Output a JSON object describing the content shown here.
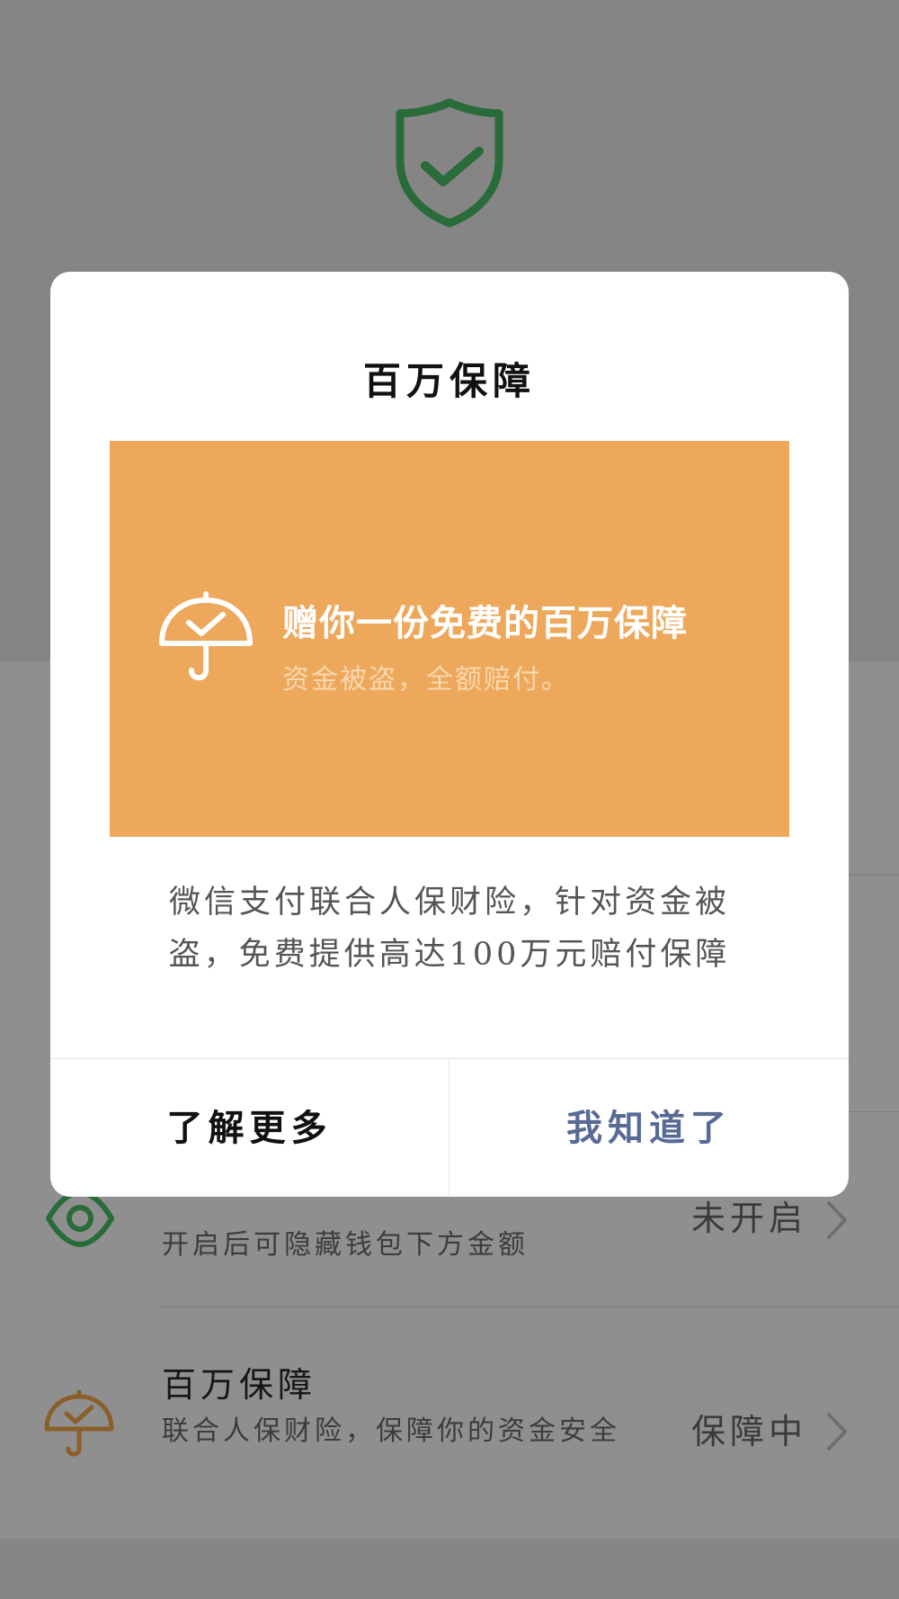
{
  "colors": {
    "overlay_bg": "#8a8a8a",
    "shield_green": "#2a6b3a",
    "banner_orange": "#eda85c",
    "primary_link": "#576b95",
    "umbrella_brown": "#8a5f2a"
  },
  "background": {
    "header_icon": "shield-check-icon",
    "rows": [
      {
        "icon": "eye-icon",
        "description": "开启后可隐藏钱包下方金额",
        "status": "未开启"
      },
      {
        "icon": "umbrella-check-icon",
        "title": "百万保障",
        "description": "联合人保财险，保障你的资金安全",
        "status": "保障中"
      }
    ]
  },
  "dialog": {
    "title": "百万保障",
    "banner": {
      "icon": "umbrella-check-icon",
      "heading": "赠你一份免费的百万保障",
      "subheading": "资金被盗，全额赔付。"
    },
    "body_line1": "微信支付联合人保财险，针对资金被",
    "body_line2": "盗，免费提供高达100万元赔付保障",
    "buttons": {
      "learn_more": "了解更多",
      "got_it": "我知道了"
    }
  }
}
